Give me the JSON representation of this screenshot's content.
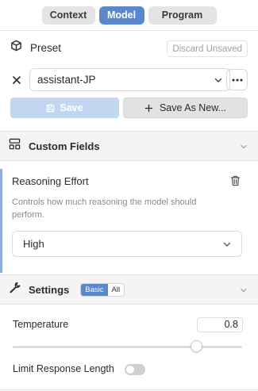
{
  "tabs": [
    {
      "label": "Context",
      "active": false
    },
    {
      "label": "Model",
      "active": true
    },
    {
      "label": "Program",
      "active": false
    }
  ],
  "preset": {
    "title": "Preset",
    "discard_label": "Discard Unsaved",
    "selected": "assistant-JP",
    "save_label": "Save",
    "save_as_label": "Save As New..."
  },
  "custom_fields": {
    "title": "Custom Fields",
    "field": {
      "name": "Reasoning Effort",
      "description": "Controls how much reasoning the model should perform.",
      "value": "High"
    }
  },
  "settings": {
    "title": "Settings",
    "mode_options": [
      "Basic",
      "All"
    ],
    "mode_selected": "Basic",
    "temperature": {
      "label": "Temperature",
      "value": "0.8",
      "slider_fraction": 0.8
    },
    "limit_response_length": {
      "label": "Limit Response Length",
      "enabled": false
    }
  },
  "colors": {
    "accent": "#5b88cc",
    "accent_light": "#c2d6f2",
    "panel_border": "#8eaee0"
  }
}
